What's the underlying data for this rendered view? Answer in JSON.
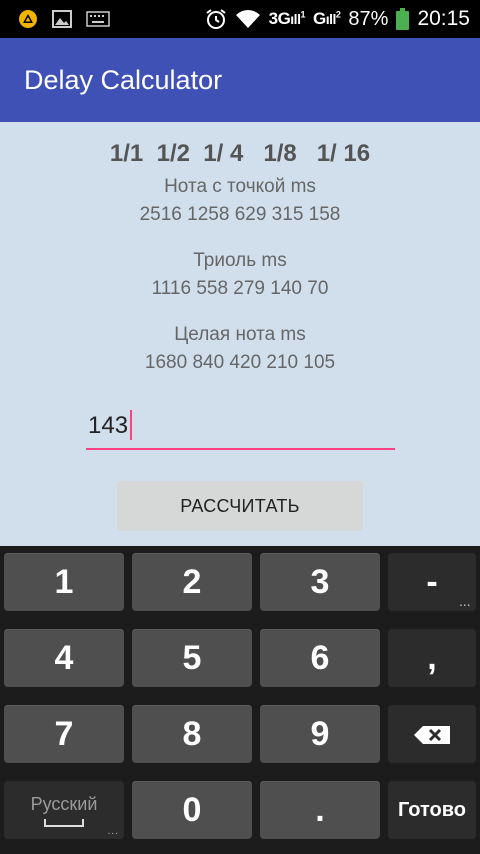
{
  "status_bar": {
    "network_1": "3G",
    "network_2": "G",
    "sim1": "1",
    "sim2": "2",
    "battery": "87%",
    "time": "20:15"
  },
  "app": {
    "title": "Delay Calculator"
  },
  "content": {
    "fractions": "1/1  1/2  1/ 4   1/8   1/ 16",
    "dotted_label": "Нота с точкой ms",
    "dotted_values": "2516 1258 629 315 158",
    "triplet_label": "Триоль ms",
    "triplet_values": "1116 558 279 140 70",
    "whole_label": "Целая нота ms",
    "whole_values": "1680 840 420 210 105",
    "bpm_value": "143",
    "calc_button": "РАССЧИТАТЬ"
  },
  "keyboard": {
    "k1": "1",
    "k2": "2",
    "k3": "3",
    "minus": "-",
    "k4": "4",
    "k5": "5",
    "k6": "6",
    "comma": ",",
    "k7": "7",
    "k8": "8",
    "k9": "9",
    "language": "Русский",
    "k0": "0",
    "dot": ".",
    "done": "Готово",
    "hint": "..."
  }
}
